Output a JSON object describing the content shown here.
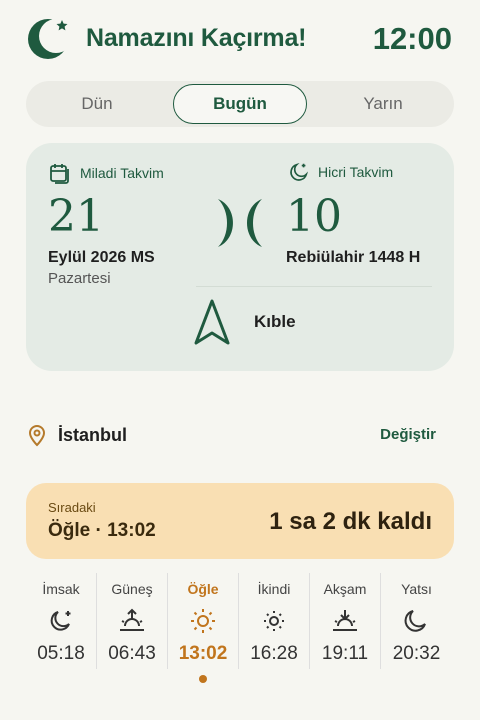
{
  "header": {
    "title": "Namazını Kaçırma!",
    "clock": "12:00",
    "logo_icon": "crescent-star-icon"
  },
  "tabs": [
    {
      "label": "Dün",
      "active": false
    },
    {
      "label": "Bugün",
      "active": true
    },
    {
      "label": "Yarın",
      "active": false
    }
  ],
  "calendar": {
    "gregorian": {
      "heading": "Miladi Takvim",
      "icon": "calendar-icon",
      "day": "21",
      "month_year": "Eylül 2026 MS",
      "weekday": "Pazartesi"
    },
    "hijri": {
      "heading": "Hicri Takvim",
      "icon": "crescent-star-icon",
      "day": "10",
      "month_year": "Rebiülahir 1448 H"
    },
    "qibla_label": "Kıble"
  },
  "location": {
    "city": "İstanbul",
    "change_label": "Değiştir",
    "icon": "location-pin-icon"
  },
  "next_prayer": {
    "label": "Sıradaki",
    "name_time": "Öğle · 13:02",
    "remaining": "1 sa 2 dk kaldı"
  },
  "prayer_times": [
    {
      "name": "İmsak",
      "time": "05:18",
      "icon": "moon-star-icon"
    },
    {
      "name": "Güneş",
      "time": "06:43",
      "icon": "sunrise-icon"
    },
    {
      "name": "Öğle",
      "time": "13:02",
      "icon": "sun-icon",
      "active": true
    },
    {
      "name": "İkindi",
      "time": "16:28",
      "icon": "sun-small-icon"
    },
    {
      "name": "Akşam",
      "time": "19:11",
      "icon": "sunset-icon"
    },
    {
      "name": "Yatsı",
      "time": "20:32",
      "icon": "moon-icon"
    }
  ],
  "colors": {
    "primary": "#1f5a3f",
    "accent": "#c1751d",
    "card_green": "#e4ebe5",
    "card_amber": "#f9dfb3",
    "background": "#f6f6f1"
  }
}
